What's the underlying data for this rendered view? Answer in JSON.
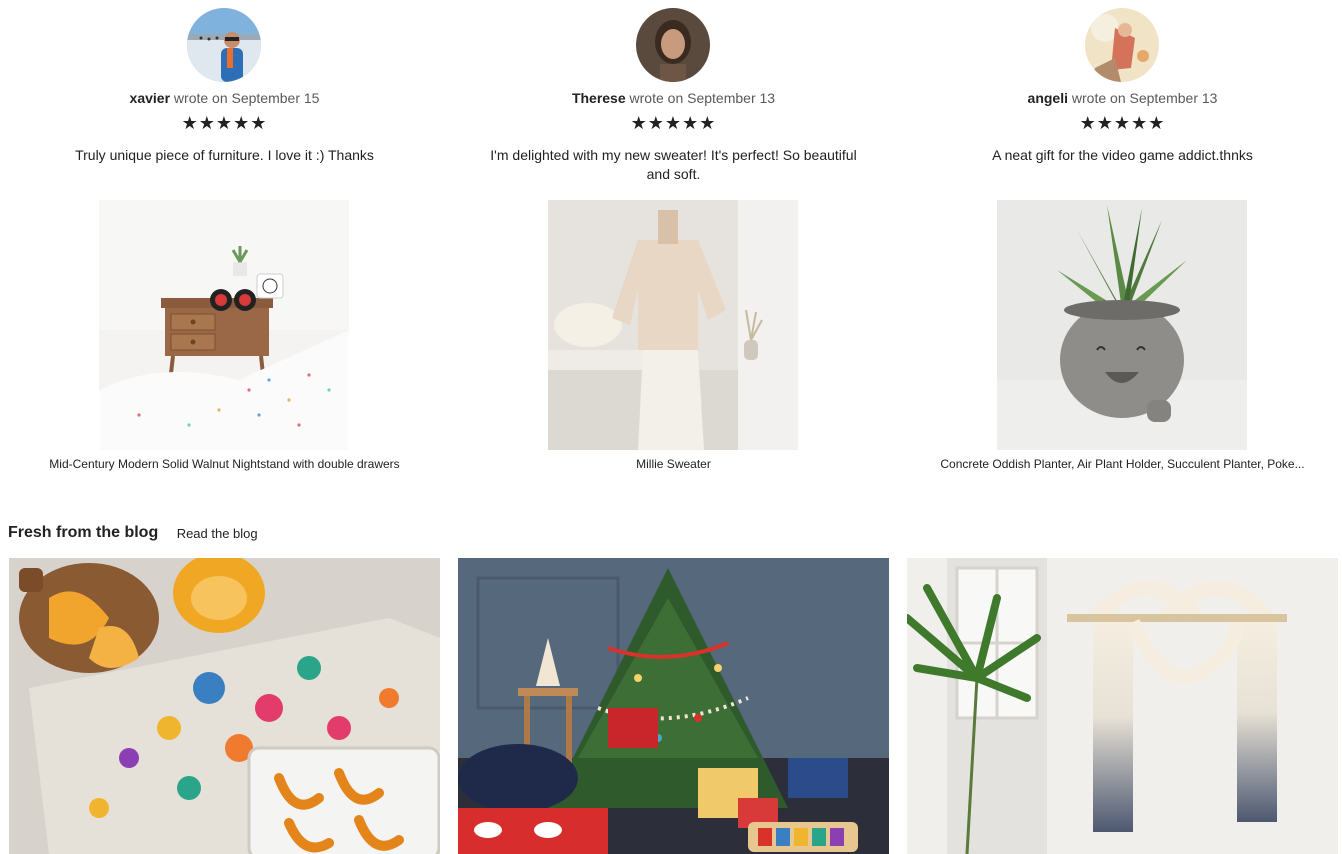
{
  "reviews": [
    {
      "reviewer": "xavier",
      "wrote_on": "wrote on September 15",
      "rating": 5,
      "stars": "★★★★★",
      "text": "Truly unique piece of furniture. I love it :) Thanks",
      "product_title": "Mid-Century Modern Solid Walnut Nightstand with double drawers"
    },
    {
      "reviewer": "Therese",
      "wrote_on": "wrote on September 13",
      "rating": 5,
      "stars": "★★★★★",
      "text": "I'm delighted with my new sweater! It's perfect! So beautiful and soft.",
      "product_title": "Millie Sweater"
    },
    {
      "reviewer": "angeli",
      "wrote_on": "wrote on September 13",
      "rating": 5,
      "stars": "★★★★★",
      "text": "A neat gift for the video game addict.thnks",
      "product_title": "Concrete Oddish Planter, Air Plant Holder, Succulent Planter, Poke..."
    }
  ],
  "blog": {
    "title": "Fresh from the blog",
    "read_link": "Read the blog"
  },
  "colors": {
    "text": "#222222",
    "muted": "#595959",
    "background": "#ffffff"
  }
}
